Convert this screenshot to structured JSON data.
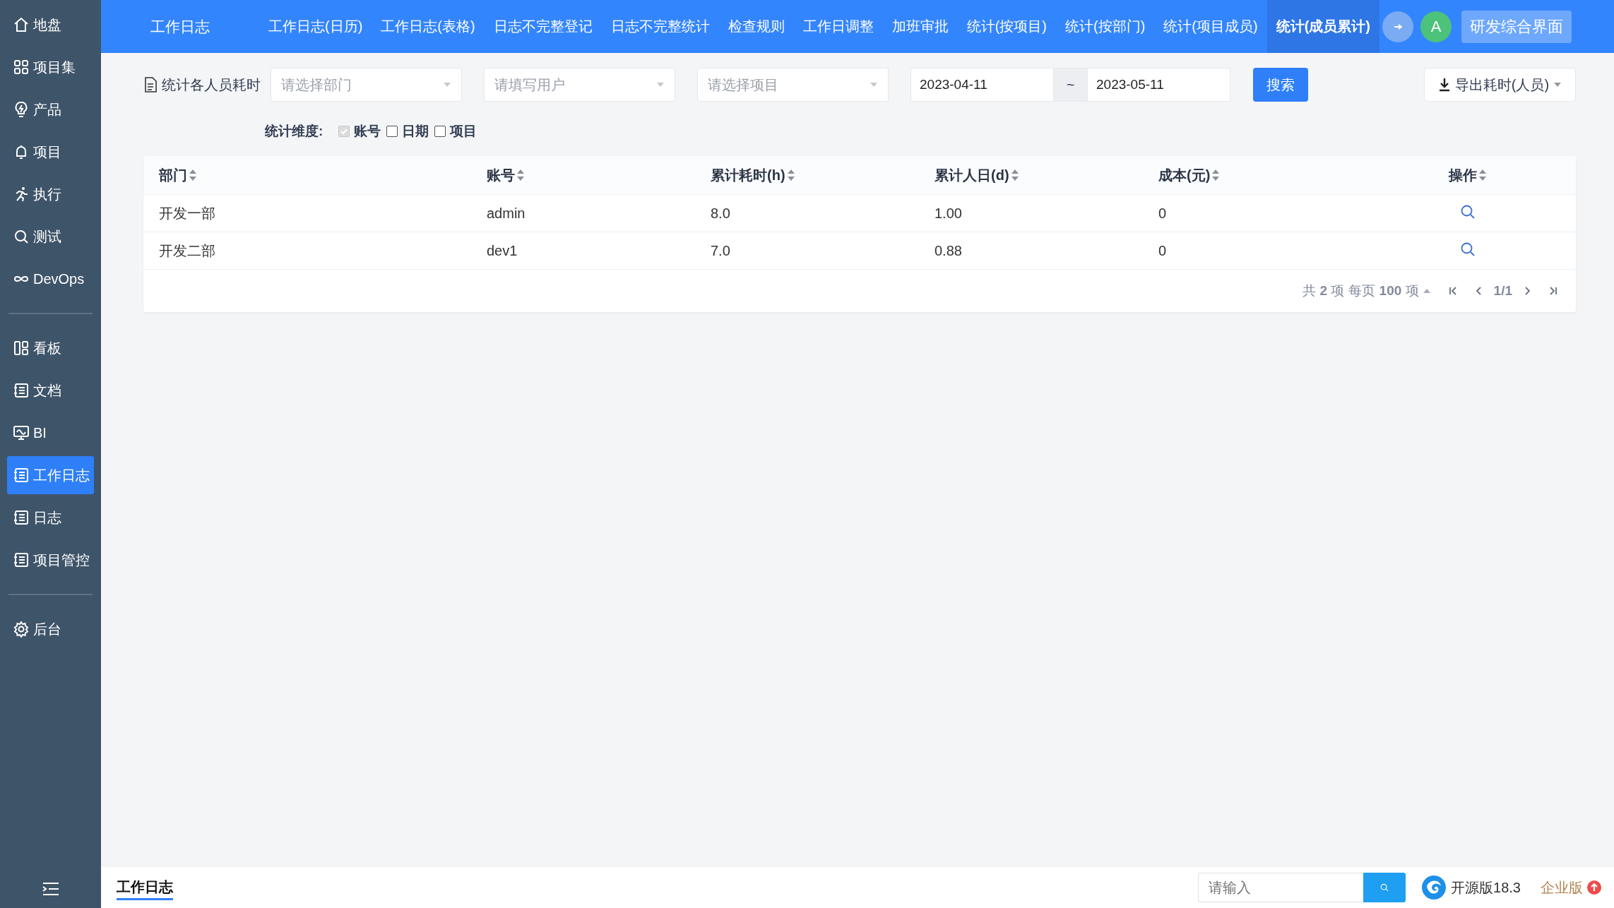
{
  "sidebar": {
    "groups": [
      [
        {
          "label": "地盘",
          "selected": false
        },
        {
          "label": "项目集",
          "selected": false
        },
        {
          "label": "产品",
          "selected": false
        },
        {
          "label": "项目",
          "selected": false
        },
        {
          "label": "执行",
          "selected": false
        },
        {
          "label": "测试",
          "selected": false
        },
        {
          "label": "DevOps",
          "selected": false
        }
      ],
      [
        {
          "label": "看板",
          "selected": false
        },
        {
          "label": "文档",
          "selected": false
        },
        {
          "label": "BI",
          "selected": false
        },
        {
          "label": "工作日志",
          "selected": true
        },
        {
          "label": "日志",
          "selected": false
        },
        {
          "label": "项目管控",
          "selected": false
        }
      ],
      [
        {
          "label": "后台",
          "selected": false
        }
      ]
    ]
  },
  "header": {
    "title": "工作日志",
    "tabs": [
      {
        "label": "工作日志(日历)",
        "selected": false
      },
      {
        "label": "工作日志(表格)",
        "selected": false
      },
      {
        "label": "日志不完整登记",
        "selected": false
      },
      {
        "label": "日志不完整统计",
        "selected": false
      },
      {
        "label": "检查规则",
        "selected": false
      },
      {
        "label": "工作日调整",
        "selected": false
      },
      {
        "label": "加班审批",
        "selected": false
      },
      {
        "label": "统计(按项目)",
        "selected": false
      },
      {
        "label": "统计(按部门)",
        "selected": false
      },
      {
        "label": "统计(项目成员)",
        "selected": false
      },
      {
        "label": "统计(成员累计)",
        "selected": true
      }
    ],
    "avatar": "A",
    "button": "研发综合界面"
  },
  "filters": {
    "title": "统计各人员耗时",
    "selects": [
      {
        "placeholder": "请选择部门"
      },
      {
        "placeholder": "请填写用户"
      },
      {
        "placeholder": "请选择项目"
      }
    ],
    "date_from": "2023-04-11",
    "separator": "~",
    "date_to": "2023-05-11",
    "search": "搜索",
    "export": "导出耗时(人员)"
  },
  "dimensions": {
    "label": "统计维度:",
    "options": [
      {
        "label": "账号",
        "checked": true,
        "disabled": true
      },
      {
        "label": "日期",
        "checked": false,
        "disabled": false
      },
      {
        "label": "项目",
        "checked": false,
        "disabled": false
      }
    ]
  },
  "table": {
    "columns": [
      "部门",
      "账号",
      "累计耗时(h)",
      "累计人日(d)",
      "成本(元)",
      "操作"
    ],
    "rows": [
      [
        "开发一部",
        "admin",
        "8.0",
        "1.00",
        "0"
      ],
      [
        "开发二部",
        "dev1",
        "7.0",
        "0.88",
        "0"
      ]
    ],
    "pagination": {
      "total_prefix": "共",
      "total": "2",
      "total_suffix": "项",
      "per_page_prefix": "每页",
      "per_page": "100",
      "per_page_suffix": "项",
      "page": "1/1"
    }
  },
  "footer": {
    "title": "工作日志",
    "search_placeholder": "请输入",
    "version": "开源版18.3",
    "upgrade": "企业版"
  }
}
